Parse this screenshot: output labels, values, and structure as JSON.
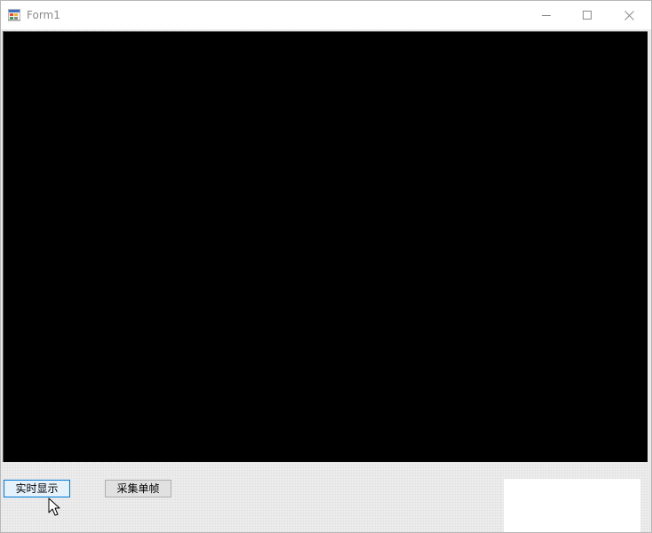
{
  "window": {
    "title": "Form1",
    "caption_buttons": {
      "minimize_icon": "minimize-icon",
      "maximize_icon": "maximize-icon",
      "close_icon": "close-icon"
    }
  },
  "main": {
    "video_display_color": "#000000",
    "buttons": {
      "live_display_label": "实时显示",
      "capture_frame_label": "采集单帧"
    }
  },
  "colors": {
    "focus_border": "#0078d7",
    "client_background": "#ebebeb"
  }
}
